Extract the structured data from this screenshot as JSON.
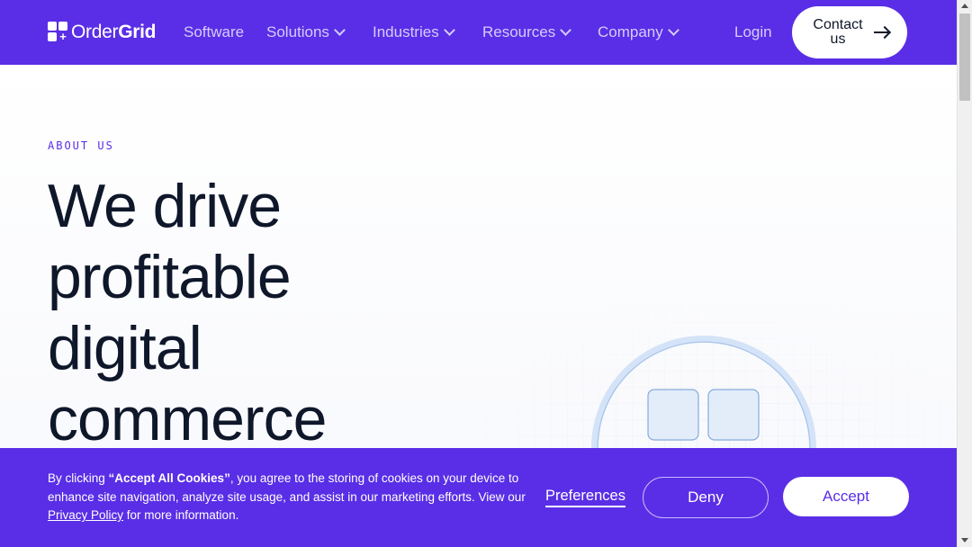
{
  "nav": {
    "logo": {
      "text_regular": "Order",
      "text_bold": "Grid",
      "plus": "+"
    },
    "items": [
      {
        "label": "Software",
        "dropdown": false
      },
      {
        "label": "Solutions",
        "dropdown": true
      },
      {
        "label": "Industries",
        "dropdown": true
      },
      {
        "label": "Resources",
        "dropdown": true
      },
      {
        "label": "Company",
        "dropdown": true
      }
    ],
    "login": "Login",
    "contact_line1": "Contact",
    "contact_line2": "us",
    "contact_icon": "arrow-right-icon"
  },
  "hero": {
    "eyebrow": "ABOUT US",
    "headline_lines": [
      "We drive",
      "profitable",
      "digital",
      "commerce"
    ]
  },
  "cookie": {
    "text_before": "By clicking ",
    "text_bold": "“Accept All Cookies”",
    "text_mid": ", you agree to the storing of cookies on your device to enhance site navigation, analyze site usage, and assist in our marketing efforts. View our ",
    "link": "Privacy Policy",
    "text_after": " for more information.",
    "preferences": "Preferences",
    "deny": "Deny",
    "accept": "Accept"
  },
  "colors": {
    "brand": "#5a2ee6",
    "headline": "#0f172a",
    "nav_text": "#d6ccff"
  }
}
